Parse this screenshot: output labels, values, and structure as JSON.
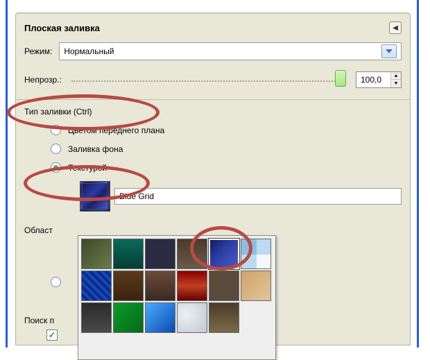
{
  "title": "Плоская заливка",
  "mode_label": "Режим:",
  "mode_value": "Нормальный",
  "opacity_label": "Непрозр.:",
  "opacity_value": "100,0",
  "fill_type_legend": "Тип заливки (Ctrl)",
  "fill_type_options": {
    "fg": "Цветом переднего плана",
    "bg": "Заливка фона",
    "pattern": "Текстурой"
  },
  "pattern_name": "Blue Grid",
  "area_label": "Област",
  "search_label": "Поиск п",
  "icons": {
    "collapse": "◀",
    "chevron": "▾",
    "up": "▲",
    "down": "▼",
    "check": "✓"
  }
}
